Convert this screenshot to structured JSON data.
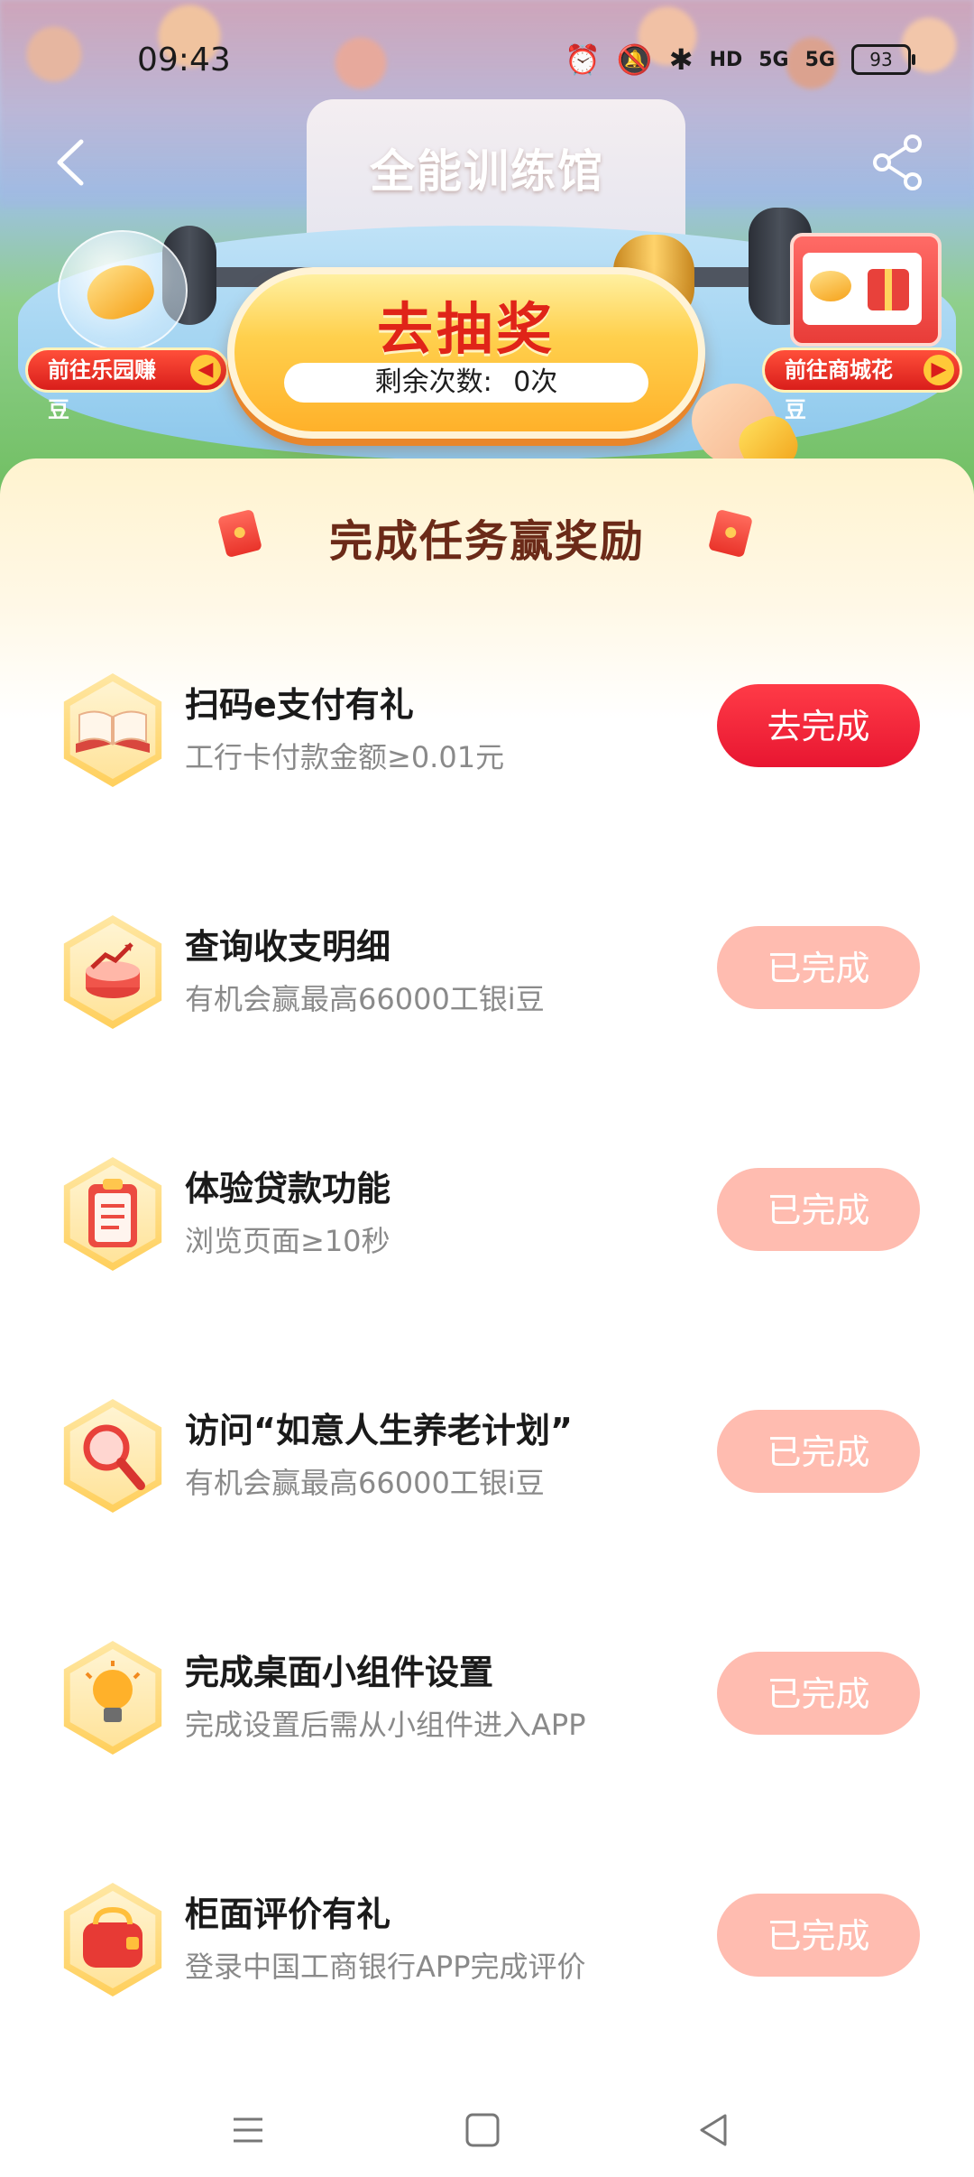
{
  "status_bar": {
    "time": "09:43",
    "battery": "93",
    "hd_label": "HD",
    "sig1": "5G",
    "sig2": "5G"
  },
  "header": {
    "title": "全能训练馆"
  },
  "hero": {
    "lottery_label": "去抽奖",
    "remaining_label": "剩余次数:",
    "remaining_value": "0次",
    "left_badge": "前往乐园赚豆",
    "right_badge": "前往商城花豆"
  },
  "tasks_section": {
    "title": "完成任务赢奖励",
    "items": [
      {
        "name": "扫码e支付有礼",
        "desc": "工行卡付款金额≥0.01元",
        "button": "去完成",
        "state": "pending",
        "icon": "book-icon"
      },
      {
        "name": "查询收支明细",
        "desc": "有机会赢最高66000工银i豆",
        "button": "已完成",
        "state": "done",
        "icon": "chart-cake-icon"
      },
      {
        "name": "体验贷款功能",
        "desc": "浏览页面≥10秒",
        "button": "已完成",
        "state": "done",
        "icon": "clipboard-icon"
      },
      {
        "name": "访问“如意人生养老计划”",
        "desc": "有机会赢最高66000工银i豆",
        "button": "已完成",
        "state": "done",
        "icon": "magnifier-icon"
      },
      {
        "name": "完成桌面小组件设置",
        "desc": "完成设置后需从小组件进入APP",
        "button": "已完成",
        "state": "done",
        "icon": "lightbulb-icon"
      },
      {
        "name": "柜面评价有礼",
        "desc": "登录中国工商银行APP完成评价",
        "button": "已完成",
        "state": "done",
        "icon": "purse-icon"
      }
    ]
  },
  "colors": {
    "go_button": "#e81631",
    "done_button": "#ffbcb0",
    "title_brown": "#6b2a18"
  }
}
